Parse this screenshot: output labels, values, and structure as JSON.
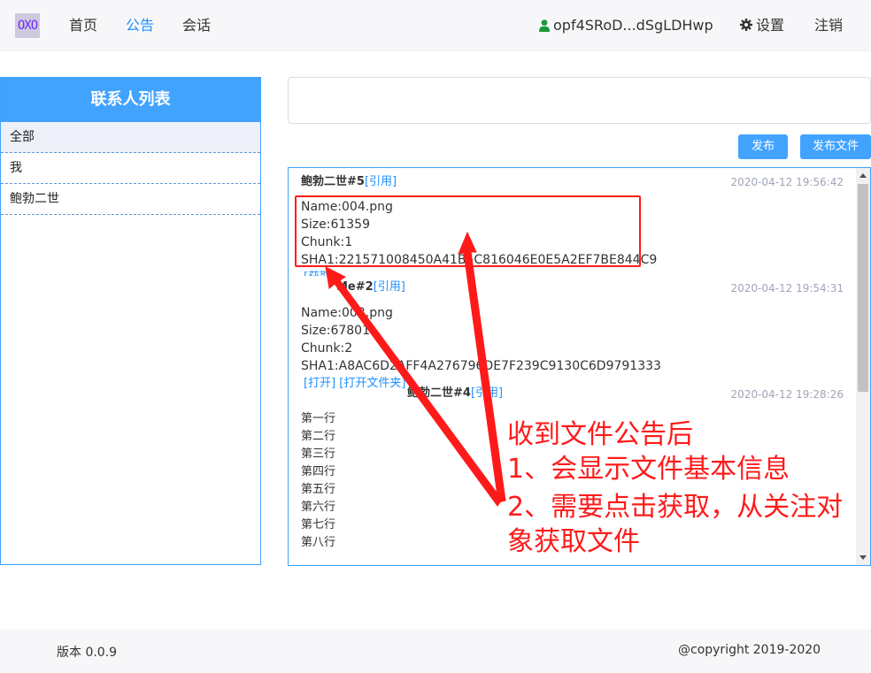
{
  "nav": {
    "logo_text": "OXO",
    "links": [
      "首页",
      "公告",
      "会话"
    ],
    "active": "公告",
    "user_id": "opf4SRoD...dSgLDHwp",
    "settings_label": "设置",
    "logout_label": "注销",
    "colors": {
      "accent": "#1e90ff",
      "user_icon": "#1a9a3a"
    }
  },
  "sidebar": {
    "title": "联系人列表",
    "contacts": [
      "全部",
      "我",
      "鲍勃二世"
    ],
    "selected": "全部"
  },
  "compose": {
    "value": "",
    "publish_label": "发布",
    "publish_file_label": "发布文件"
  },
  "feed": {
    "posts": [
      {
        "author": "鲍勃二世#5",
        "quote_label": "[引用]",
        "time": "2020-04-12 19:56:42",
        "lines": [
          "Name:004.png",
          "Size:61359",
          "Chunk:1",
          "SHA1:221571008450A41B5C816046E0E5A2EF7BE844C9"
        ],
        "actions": [
          "[获取]"
        ]
      },
      {
        "author": "Me#2",
        "quote_label": "[引用]",
        "time": "2020-04-12 19:54:31",
        "lines": [
          "Name:003.png",
          "Size:67801",
          "Chunk:2",
          "SHA1:A8AC6D2AFF4A276796DE7F239C9130C6D9791333"
        ],
        "actions": [
          "[打开]",
          "[打开文件夹]"
        ]
      },
      {
        "author": "鲍勃二世#4",
        "quote_label": "[引用]",
        "time": "2020-04-12 19:28:26",
        "lines": [
          "第一行",
          "第二行",
          "第三行",
          "第四行",
          "第五行",
          "第六行",
          "第七行",
          "第八行"
        ],
        "actions": []
      }
    ]
  },
  "annotation": {
    "lines": [
      "收到文件公告后",
      "1、会显示文件基本信息",
      "2、需要点击获取，从关注对",
      "象获取文件"
    ],
    "color": "#ff1a1a"
  },
  "footer": {
    "version": "版本 0.0.9",
    "copyright": "@copyright 2019-2020"
  }
}
